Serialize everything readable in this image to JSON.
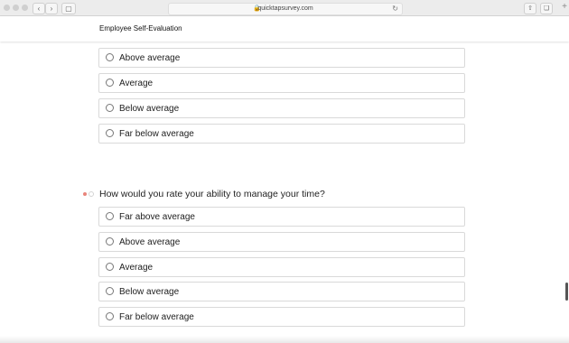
{
  "browser": {
    "url": "quicktapsurvey.com",
    "icons": [
      "back-icon",
      "forward-icon",
      "sidebar-icon",
      "lock-icon",
      "reload-icon",
      "share-icon",
      "tabs-icon",
      "new-tab-icon"
    ]
  },
  "header": {
    "title": "Employee Self-Evaluation"
  },
  "question_prev": {
    "options": [
      "Above average",
      "Average",
      "Below average",
      "Far below average"
    ]
  },
  "question_time": {
    "text": "How would you rate your ability to manage your time?",
    "options": [
      "Far above average",
      "Above average",
      "Average",
      "Below average",
      "Far below average"
    ]
  },
  "colors": {
    "required_marker": "#e9847a",
    "option_border": "#d9d9d9"
  }
}
